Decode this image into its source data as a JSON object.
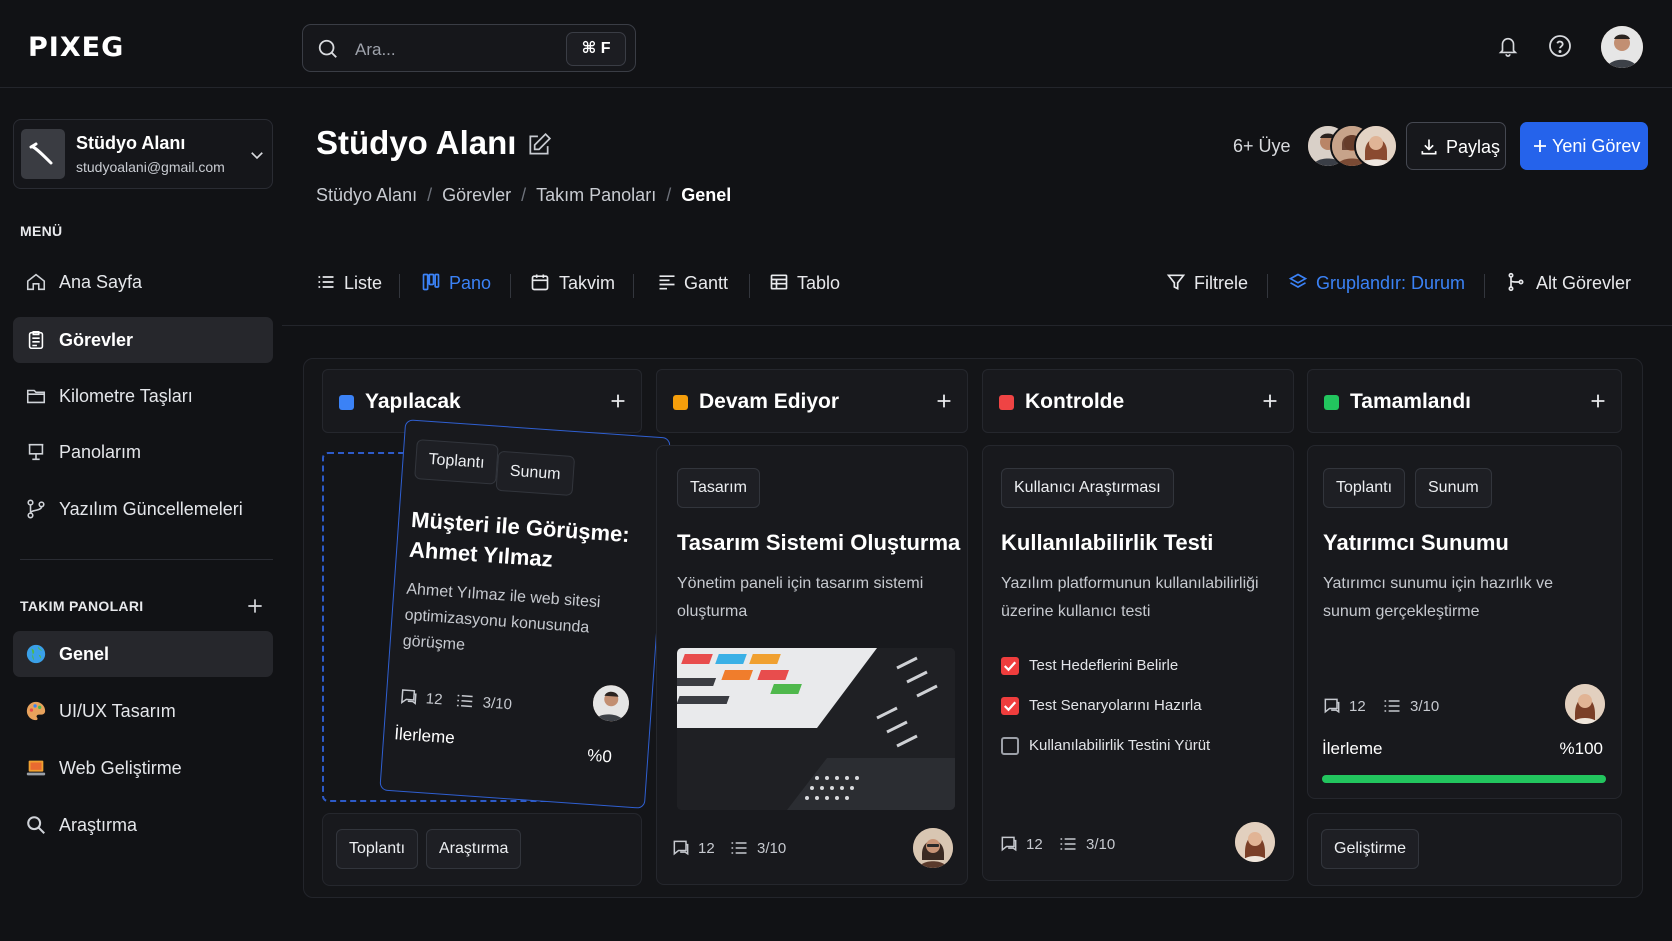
{
  "brand": {
    "logo": "PIXEG"
  },
  "search": {
    "placeholder": "Ara...",
    "shortcut": "⌘ F"
  },
  "workspace": {
    "name": "Stüdyo Alanı",
    "email": "studyoalani@gmail.com"
  },
  "menu": {
    "label": "MENÜ",
    "items": [
      {
        "label": "Ana Sayfa",
        "icon": "home-icon"
      },
      {
        "label": "Görevler",
        "icon": "clipboard-icon",
        "active": true
      },
      {
        "label": "Kilometre Taşları",
        "icon": "folder-icon"
      },
      {
        "label": "Panolarım",
        "icon": "board-icon"
      },
      {
        "label": "Yazılım Güncellemeleri",
        "icon": "branch-icon"
      }
    ]
  },
  "teams": {
    "label": "TAKIM PANOLARI",
    "items": [
      {
        "label": "Genel",
        "icon": "globe-icon",
        "active": true
      },
      {
        "label": "UI/UX Tasarım",
        "icon": "palette-icon"
      },
      {
        "label": "Web Geliştirme",
        "icon": "laptop-icon"
      },
      {
        "label": "Araştırma",
        "icon": "magnifier-icon"
      }
    ]
  },
  "header": {
    "title": "Stüdyo Alanı",
    "breadcrumb": [
      "Stüdyo Alanı",
      "Görevler",
      "Takım Panoları",
      "Genel"
    ],
    "members": "6+ Üye",
    "share": "Paylaş",
    "new_task": "Yeni Görev"
  },
  "views": {
    "tabs": [
      "Liste",
      "Pano",
      "Takvim",
      "Gantt",
      "Tablo"
    ],
    "active": "Pano",
    "filter": "Filtrele",
    "group": "Gruplandır: Durum",
    "subtasks": "Alt Görevler"
  },
  "columns": [
    {
      "title": "Yapılacak",
      "color": "#3b82f6"
    },
    {
      "title": "Devam Ediyor",
      "color": "#f59e0b"
    },
    {
      "title": "Kontrolde",
      "color": "#ef4444"
    },
    {
      "title": "Tamamlandı",
      "color": "#22c55e"
    }
  ],
  "cards": {
    "todo": {
      "tags": [
        "Toplantı",
        "Sunum"
      ],
      "title_line1": "Müşteri ile Görüşme:",
      "title_line2": "Ahmet Yılmaz",
      "desc": "Ahmet Yılmaz ile web sitesi optimizasyonu konusunda görüşme",
      "comments": "12",
      "subtasks": "3/10",
      "progress_label": "İlerleme",
      "progress": "%0"
    },
    "todo_next": {
      "tags": [
        "Toplantı",
        "Araştırma"
      ]
    },
    "progress": {
      "tags": [
        "Tasarım"
      ],
      "title": "Tasarım Sistemi Oluşturma",
      "desc": "Yönetim paneli için tasarım sistemi oluşturma",
      "comments": "12",
      "subtasks": "3/10"
    },
    "review": {
      "tags": [
        "Kullanıcı Araştırması"
      ],
      "title": "Kullanılabilirlik Testi",
      "desc": "Yazılım platformunun kullanılabilirliği üzerine kullanıcı testi",
      "checklist": [
        {
          "label": "Test Hedeflerini Belirle",
          "done": true
        },
        {
          "label": "Test Senaryolarını Hazırla",
          "done": true
        },
        {
          "label": "Kullanılabilirlik Testini Yürüt",
          "done": false
        }
      ],
      "comments": "12",
      "subtasks": "3/10"
    },
    "done": {
      "tags": [
        "Toplantı",
        "Sunum"
      ],
      "title": "Yatırımcı Sunumu",
      "desc": "Yatırımcı sunumu için hazırlık ve sunum gerçekleştirme",
      "comments": "12",
      "subtasks": "3/10",
      "progress_label": "İlerleme",
      "progress": "%100",
      "progress_value": 1.0
    },
    "done_next": {
      "tags": [
        "Geliştirme"
      ]
    }
  },
  "colors": {
    "accent": "#2563eb",
    "progress": "#22c55e",
    "check": "#ef3d3d"
  }
}
